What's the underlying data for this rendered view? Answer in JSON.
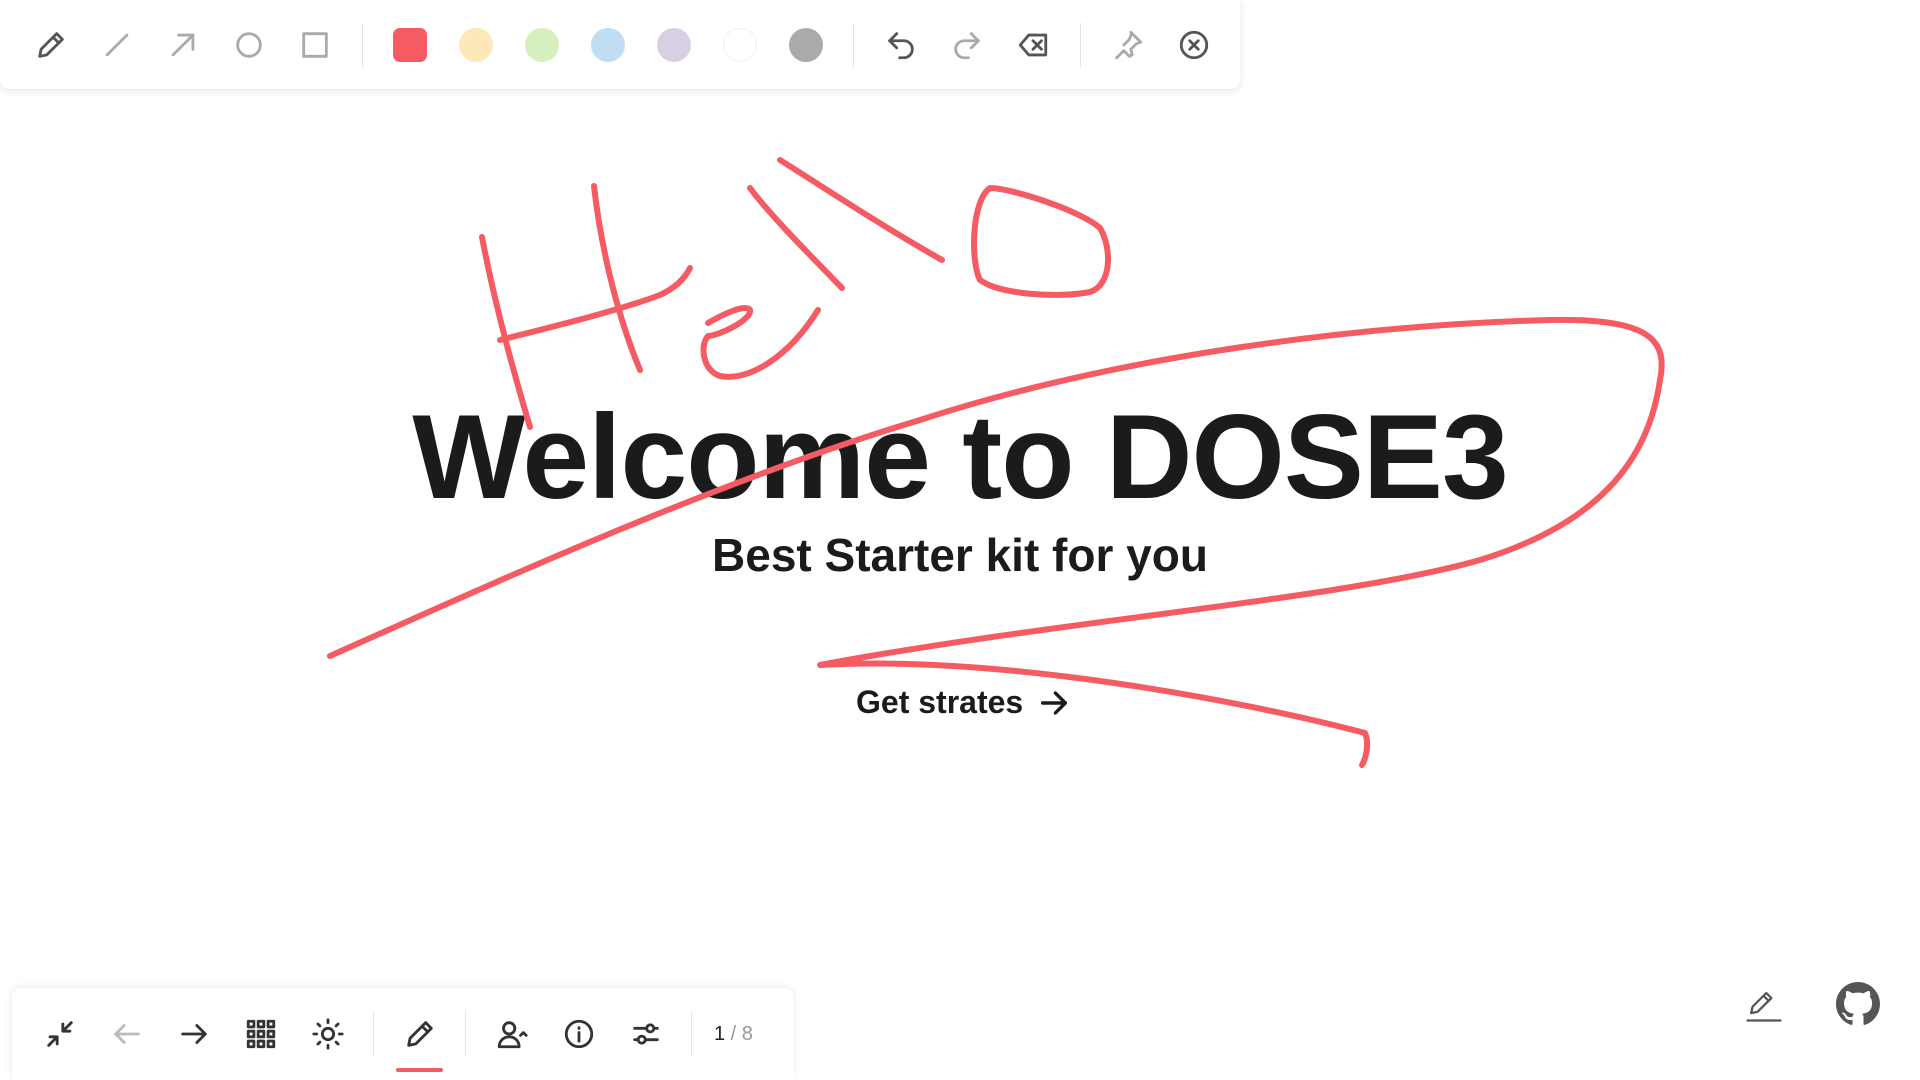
{
  "toolbar": {
    "tools": [
      {
        "name": "pen-tool",
        "icon": "pencil-icon"
      },
      {
        "name": "line-tool",
        "icon": "line-icon"
      },
      {
        "name": "arrow-tool",
        "icon": "arrow-icon"
      },
      {
        "name": "ellipse-tool",
        "icon": "circle-icon"
      },
      {
        "name": "rectangle-tool",
        "icon": "square-icon"
      }
    ],
    "colors": [
      "#f45b63",
      "#fde9b8",
      "#d5efbf",
      "#bfddf3",
      "#d9cfe5",
      "#ffffff",
      "#aaaaaa"
    ],
    "selected_color": "#f45b63",
    "actions": [
      "undo-icon",
      "redo-icon",
      "erase-icon",
      "pin-icon",
      "close-circle-icon"
    ]
  },
  "slide": {
    "title": "Welcome to DOSE3",
    "subtitle": "Best Starter kit for you",
    "cta_label": "Get strates",
    "cta_icon": "arrow-right-icon"
  },
  "annotation": {
    "color": "#f45b63",
    "handwritten_text": "Hello"
  },
  "nav": {
    "buttons": [
      "exit-fullscreen-icon",
      "prev-icon",
      "next-icon",
      "grid-icon",
      "theme-icon",
      "draw-icon",
      "presenter-icon",
      "info-icon",
      "settings-icon"
    ],
    "active": "draw-icon",
    "page_current": "1",
    "page_separator": " / ",
    "page_total": "8"
  },
  "corner": {
    "edit_icon": "edit-icon",
    "github_icon": "github-icon"
  }
}
